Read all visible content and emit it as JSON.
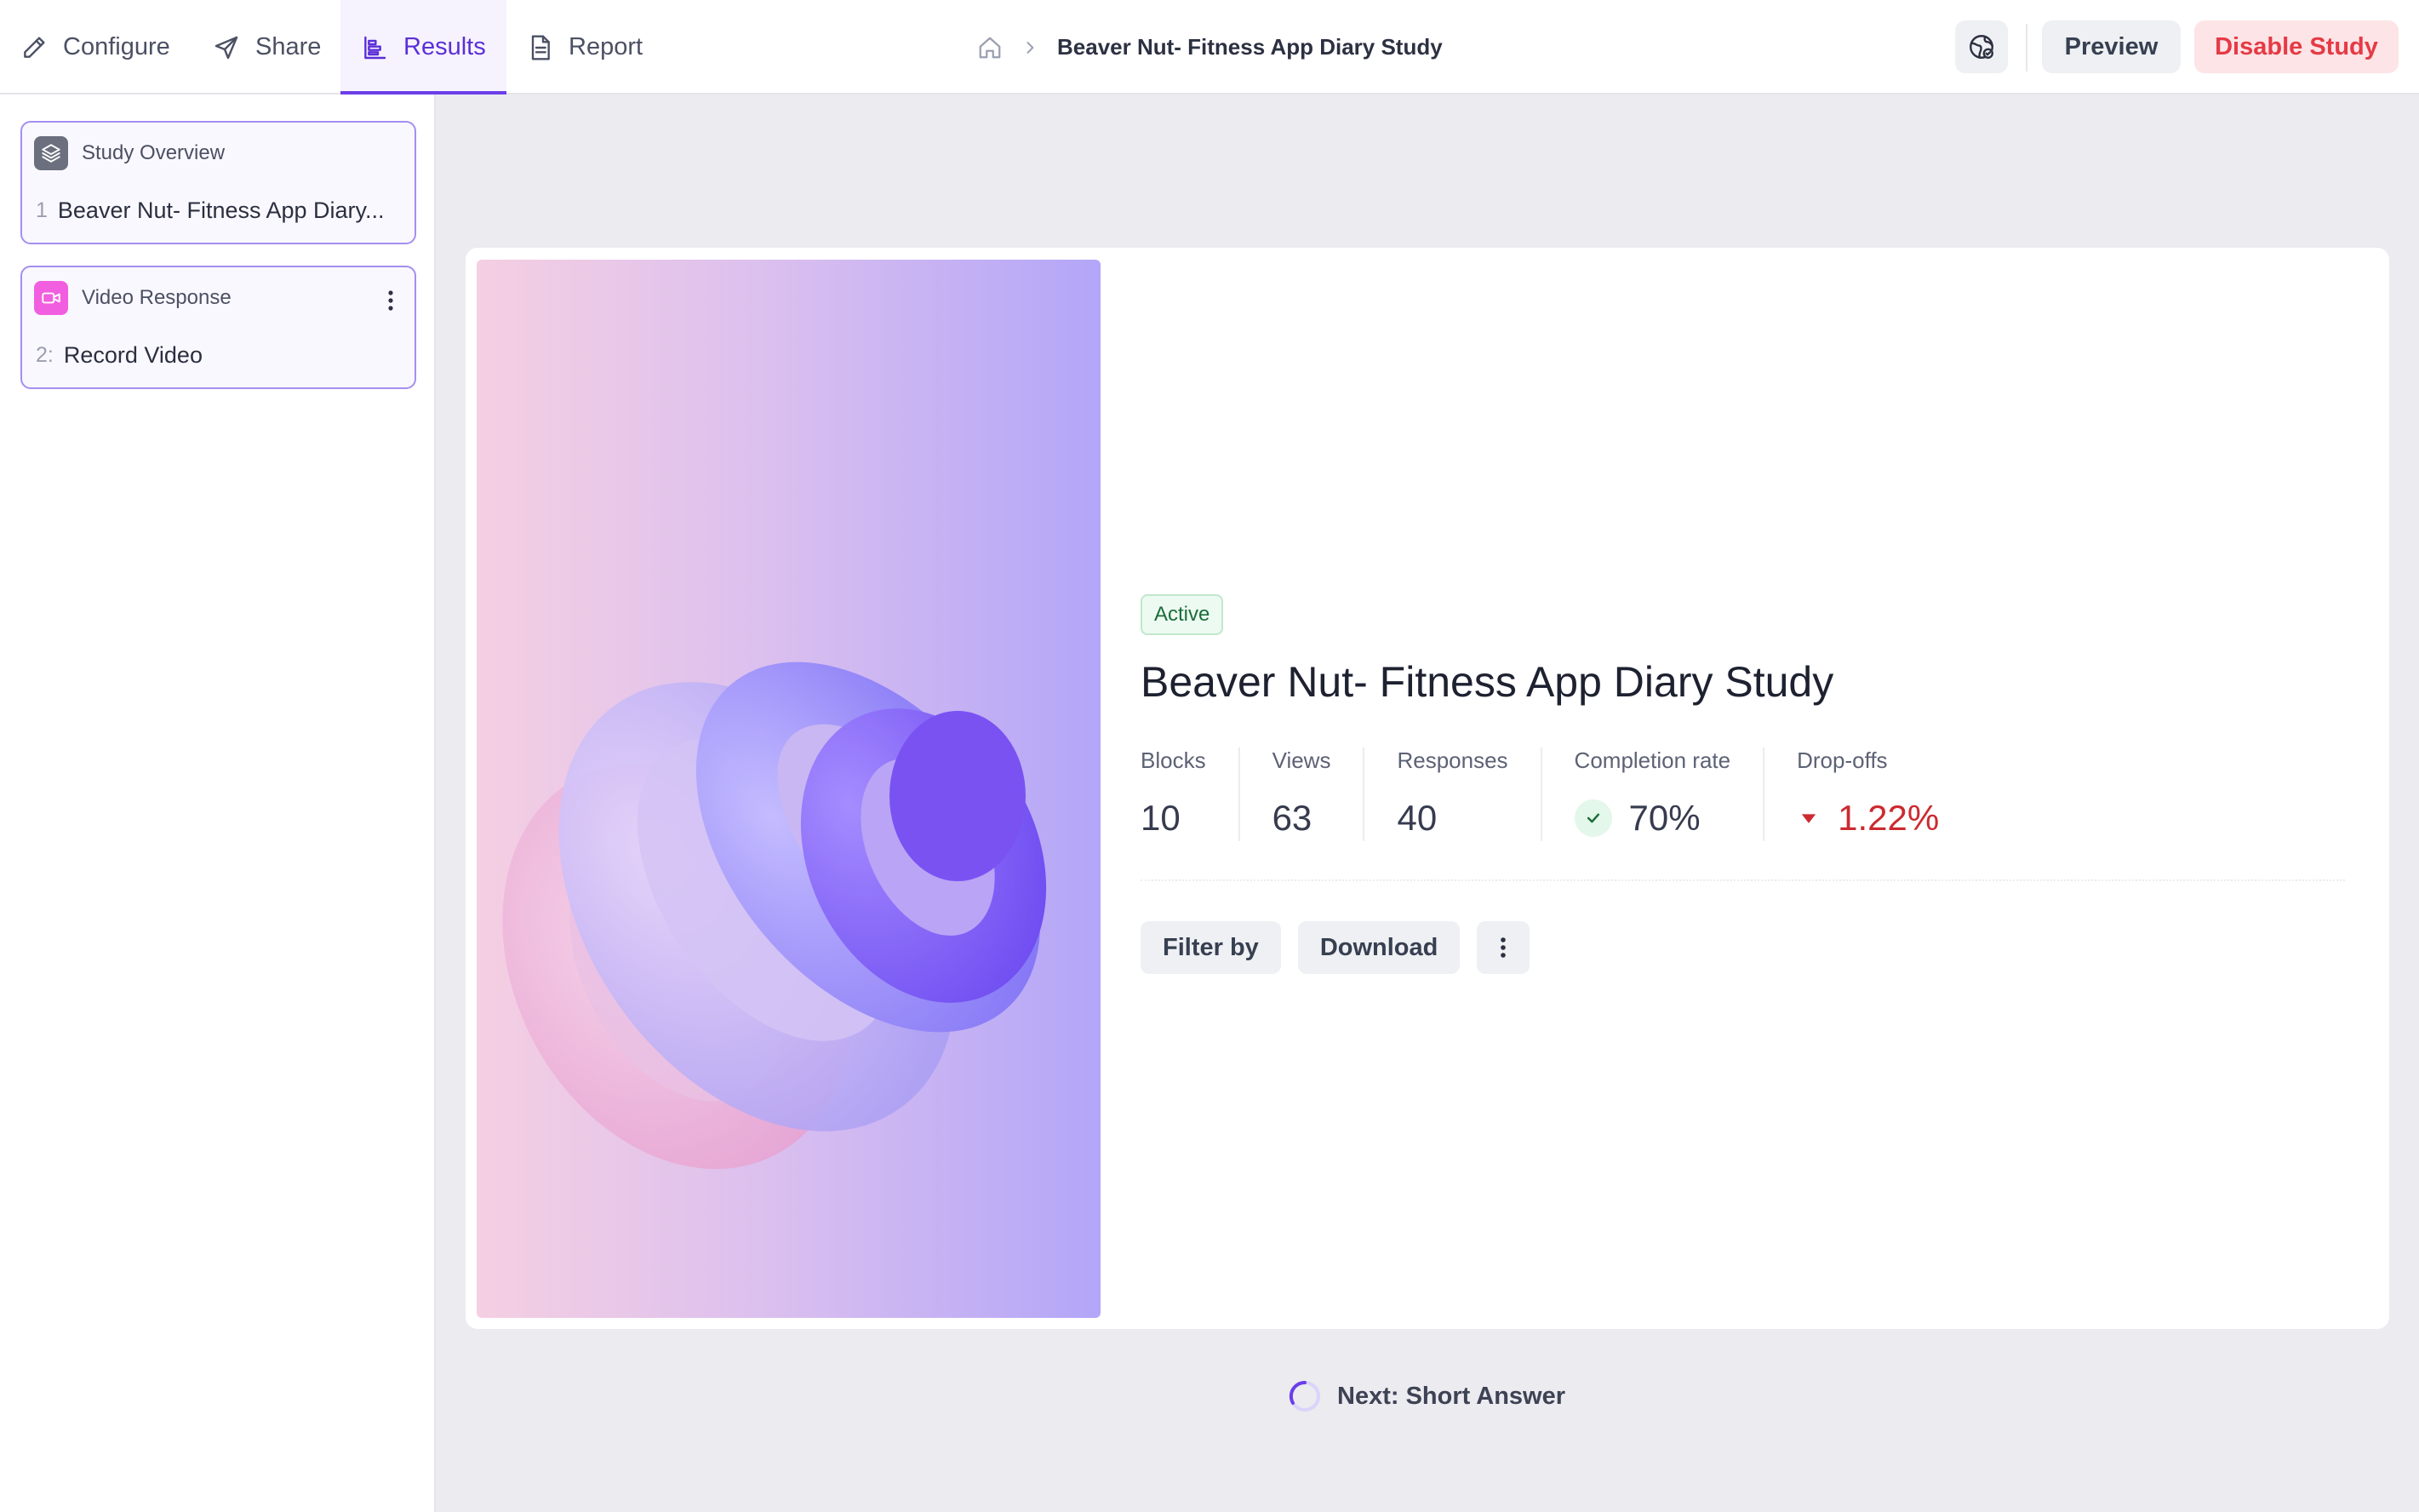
{
  "tabs": [
    {
      "label": "Configure",
      "icon": "pencil-icon"
    },
    {
      "label": "Share",
      "icon": "send-icon"
    },
    {
      "label": "Results",
      "icon": "results-chart-icon",
      "active": true
    },
    {
      "label": "Report",
      "icon": "document-icon"
    }
  ],
  "breadcrumb": {
    "home_icon": "home-icon",
    "separator_icon": "chevron-right-icon",
    "title": "Beaver Nut-  Fitness App Diary Study"
  },
  "header": {
    "globe_icon": "globe-icon",
    "preview_label": "Preview",
    "disable_label": "Disable Study"
  },
  "sidebar": {
    "blocks": [
      {
        "type_label": "Study Overview",
        "icon": "layers-icon",
        "icon_color": "#6b6f7e",
        "item_number": "1",
        "item_label": "Beaver Nut-  Fitness App Diary..."
      },
      {
        "type_label": "Video Response",
        "icon": "video-camera-icon",
        "icon_color": "#f25ee0",
        "item_number": "2:",
        "item_label": "Record Video",
        "more_icon": "kebab-icon"
      }
    ]
  },
  "main": {
    "status": "Active",
    "title": "Beaver Nut-  Fitness App Diary Study",
    "stats": [
      {
        "label": "Blocks",
        "value": "10"
      },
      {
        "label": "Views",
        "value": "63"
      },
      {
        "label": "Responses",
        "value": "40"
      },
      {
        "label": "Completion rate",
        "value": "70%",
        "icon": "check-circle-icon"
      },
      {
        "label": "Drop-offs",
        "value": "1.22%",
        "icon": "triangle-down-icon"
      }
    ],
    "actions": {
      "filter_label": "Filter by",
      "download_label": "Download",
      "more_icon": "kebab-icon"
    }
  },
  "next": {
    "label": "Next: Short Answer",
    "icon": "spinner-icon"
  },
  "colors": {
    "accent": "#6b3ee8",
    "danger": "#e53a45",
    "success": "#1b6d3a",
    "background": "#ebebf0"
  }
}
